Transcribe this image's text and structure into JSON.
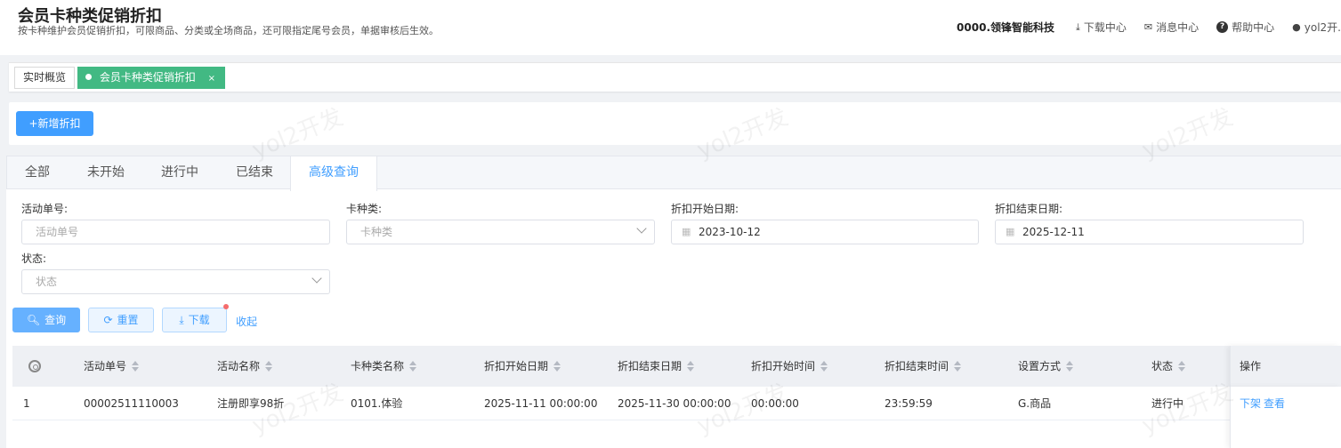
{
  "header": {
    "title": "会员卡种类促销折扣",
    "description": "按卡种维护会员促销折扣，可限商品、分类或全场商品，还可限指定尾号会员，单据审核后生效。",
    "company": "0000.领锋智能科技",
    "download_center": "下载中心",
    "message_center": "消息中心",
    "help_center": "帮助中心",
    "user": "yol2开."
  },
  "page_tabs": [
    {
      "label": "实时概览"
    },
    {
      "label": "会员卡种类促销折扣",
      "close": "×"
    }
  ],
  "actions": {
    "add_label": "+新增折扣"
  },
  "filter_tabs": [
    "全部",
    "未开始",
    "进行中",
    "已结束",
    "高级查询"
  ],
  "filters": {
    "order_no": {
      "label": "活动单号:",
      "placeholder": "活动单号"
    },
    "card_type": {
      "label": "卡种类:",
      "placeholder": "卡种类"
    },
    "start_date": {
      "label": "折扣开始日期:",
      "value": "2023-10-12"
    },
    "end_date": {
      "label": "折扣结束日期:",
      "value": "2025-12-11"
    },
    "status": {
      "label": "状态:",
      "placeholder": "状态"
    }
  },
  "buttons": {
    "search": "查询",
    "reset": "重置",
    "download": "下载",
    "collapse": "收起"
  },
  "table": {
    "columns": [
      "活动单号",
      "活动名称",
      "卡种类名称",
      "折扣开始日期",
      "折扣结束日期",
      "折扣开始时间",
      "折扣结束时间",
      "设置方式",
      "状态"
    ],
    "ops_header": "操作",
    "rows": [
      {
        "index": "1",
        "order_no": "00002511110003",
        "name": "注册即享98折",
        "card_type": "0101.体验",
        "start_date": "2025-11-11 00:00:00",
        "end_date": "2025-11-30 00:00:00",
        "start_time": "00:00:00",
        "end_time": "23:59:59",
        "mode": "G.商品",
        "status": "进行中",
        "op_offline": "下架",
        "op_view": "查看"
      }
    ]
  },
  "watermark": "yol2开发"
}
